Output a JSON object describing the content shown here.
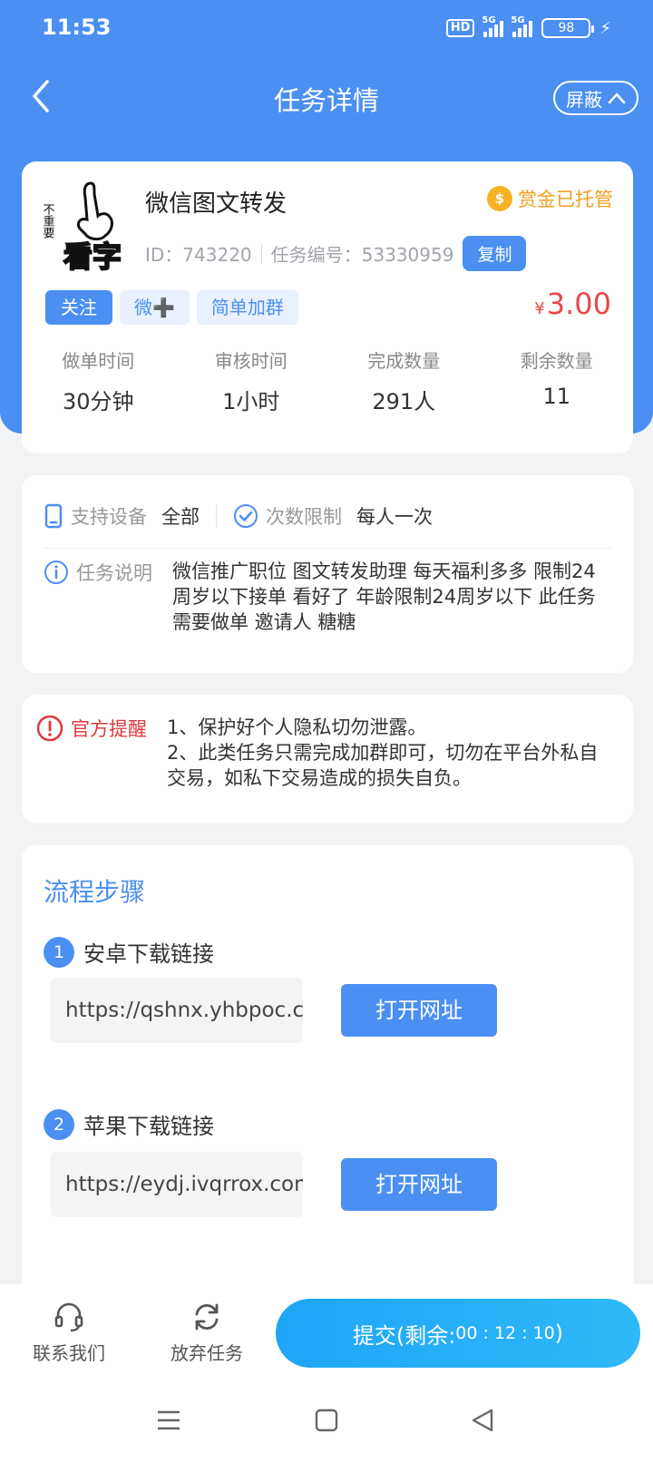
{
  "status_bar": {
    "time": "11:53",
    "hd": "HD",
    "signal1": "5G",
    "signal2": "5G",
    "battery": "98"
  },
  "nav": {
    "title": "任务详情",
    "block_label": "屏蔽"
  },
  "task": {
    "logo_text_top": "不重要",
    "logo_text_main": "看字",
    "title": "微信图文转发",
    "escrow_label": "赏金已托管",
    "coin_symbol": "$",
    "id_text": "ID：743220",
    "number_text": "任务编号：53330959",
    "copy_label": "复制",
    "tags": [
      "关注",
      "微➕",
      "简单加群"
    ],
    "price_currency": "¥",
    "price": "3.00",
    "stats": [
      {
        "label": "做单时间",
        "value": "30分钟"
      },
      {
        "label": "审核时间",
        "value": "1小时"
      },
      {
        "label": "完成数量",
        "value": "291人"
      },
      {
        "label": "剩余数量",
        "value": "11"
      }
    ]
  },
  "info": {
    "device_label": "支持设备",
    "device_value": "全部",
    "limit_label": "次数限制",
    "limit_value": "每人一次",
    "desc_label": "任务说明",
    "desc_text": "微信推广职位 图文转发助理 每天福利多多 限制24周岁以下接单 看好了 年龄限制24周岁以下 此任务需要做单 邀请人 糖糖"
  },
  "notice": {
    "label": "官方提醒",
    "line1": "1、保护好个人隐私切勿泄露。",
    "line2": "2、此类任务只需完成加群即可，切勿在平台外私自交易，如私下交易造成的损失自负。"
  },
  "steps": {
    "title": "流程步骤",
    "items": [
      {
        "num": "1",
        "label": "安卓下载链接",
        "url": "https://qshnx.yhbpoc.c",
        "button": "打开网址"
      },
      {
        "num": "2",
        "label": "苹果下载链接",
        "url": "https://eydj.ivqrrox.com",
        "button": "打开网址"
      }
    ]
  },
  "bottom": {
    "contact_label": "联系我们",
    "abandon_label": "放弃任务",
    "submit_label": "提交(剩余:",
    "submit_countdown": "00 : 12 : 10",
    "submit_close": ")"
  },
  "colors": {
    "primary": "#4b8ff2",
    "price": "#e8474a",
    "escrow": "#f0a020",
    "alert": "#e0383b",
    "submit": "#1ea5f7"
  },
  "icons": [
    "back-icon",
    "chevron-up-icon",
    "coin-icon",
    "phone-icon",
    "check-circle-icon",
    "info-icon",
    "alert-icon",
    "headset-icon",
    "refresh-icon",
    "menu-icon",
    "home-icon",
    "back-triangle-icon"
  ]
}
